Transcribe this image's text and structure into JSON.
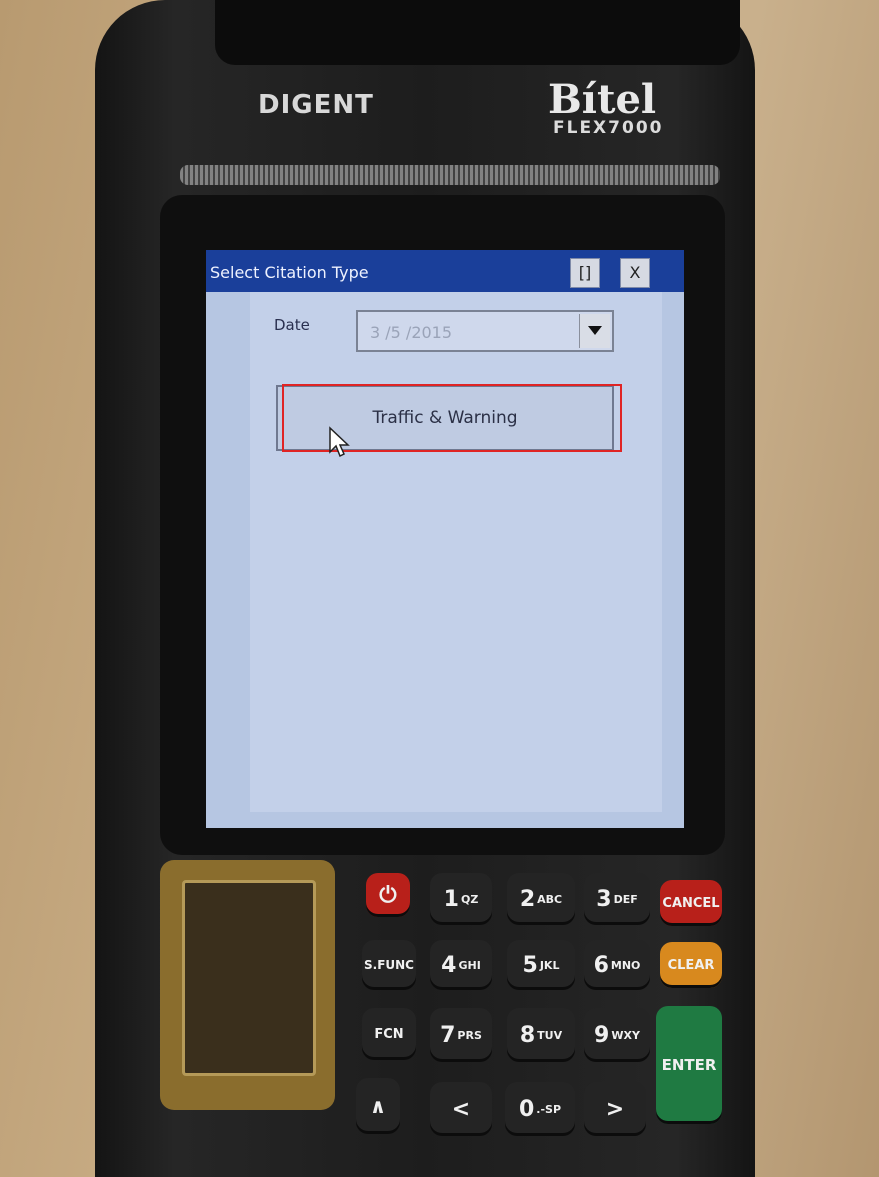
{
  "device": {
    "brand_left": "DIGENT",
    "brand_right": "Bítel",
    "model": "FLEX7000"
  },
  "window": {
    "title": "Select Citation Type",
    "restore_label": "[]",
    "close_label": "X"
  },
  "form": {
    "date_label": "Date",
    "date_value": "3 /5 /2015",
    "traffic_button_label": "Traffic & Warning"
  },
  "keypad": {
    "power": "⏻",
    "k1": {
      "num": "1",
      "sub": "QZ"
    },
    "k2": {
      "num": "2",
      "sub": "ABC"
    },
    "k3": {
      "num": "3",
      "sub": "DEF"
    },
    "cancel": "CANCEL",
    "sfunc": "S.FUNC",
    "k4": {
      "num": "4",
      "sub": "GHI"
    },
    "k5": {
      "num": "5",
      "sub": "JKL"
    },
    "k6": {
      "num": "6",
      "sub": "MNO"
    },
    "clear": "CLEAR",
    "fcn": "FCN",
    "k7": {
      "num": "7",
      "sub": "PRS"
    },
    "k8": {
      "num": "8",
      "sub": "TUV"
    },
    "k9": {
      "num": "9",
      "sub": "WXY"
    },
    "enter": "ENTER",
    "up": "∧",
    "left": "<",
    "k0": {
      "num": "0",
      "sub": ".-SP"
    },
    "right": ">"
  }
}
